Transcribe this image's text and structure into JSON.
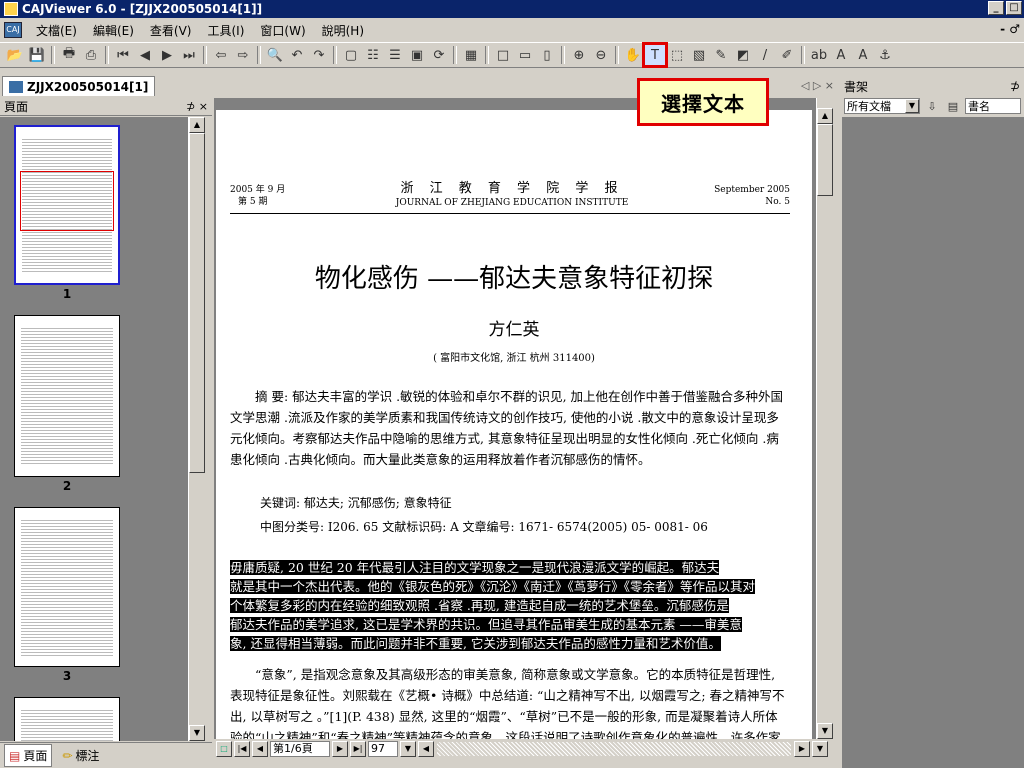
{
  "window": {
    "title": "CAJViewer 6.0 - [ZJJX200505014[1]]",
    "min": "_",
    "max": "□",
    "mdi_controls": "- ♂"
  },
  "menu": [
    "文檔(E)",
    "編輯(E)",
    "查看(V)",
    "工具(I)",
    "窗口(W)",
    "說明(H)"
  ],
  "tooltip": "選擇文本",
  "doc_tab": {
    "label": "ZJJX200505014[1]",
    "nav": "◁ ▷ ×"
  },
  "left_panel": {
    "title": "頁面",
    "controls": "⊅ ×",
    "pages": [
      "1",
      "2",
      "3"
    ]
  },
  "bottom_tabs": {
    "pages": "頁面",
    "notes": "標注"
  },
  "page": {
    "header_left": [
      "2005 年 9 月",
      "第 5 期"
    ],
    "journal_cn": "浙 江 教 育 学 院 学 报",
    "journal_en": "JOURNAL OF ZHEJIANG EDUCATION INSTITUTE",
    "header_right": [
      "September 2005",
      "No. 5"
    ],
    "title": "物化感伤 ——郁达夫意象特征初探",
    "author": "方仁英",
    "affiliation": "( 富阳市文化馆, 浙江  杭州 311400)",
    "abstract": "摘    要: 郁达夫丰富的学识 .敏锐的体验和卓尔不群的识见, 加上他在创作中善于借鉴融合多种外国文学思潮 .流派及作家的美学质素和我国传统诗文的创作技巧, 使他的小说 .散文中的意象设计呈现多元化倾向。考察郁达夫作品中隐喻的思维方式, 其意象特征呈现出明显的女性化倾向 .死亡化倾向 .病患化倾向 .古典化倾向。而大量此类意象的运用释放着作者沉郁感伤的情怀。",
    "keywords": "关键词: 郁达夫; 沉郁感伤; 意象特征",
    "classification": "中图分类号: I206. 65    文献标识码: A    文章编号: 1671- 6574(2005) 05- 0081- 06",
    "selected_lines": [
      "毋庸质疑, 20 世纪 20 年代最引人注目的文学现象之一是现代浪漫派文学的崛起。郁达夫",
      "就是其中一个杰出代表。他的《银灰色的死》《沉沦》《南迁》《茑萝行》《零余者》等作品以其对",
      "个体繁复多彩的内在经验的细致观照 .省察 .再现, 建造起自成一统的艺术堡垒。沉郁感伤是",
      "郁达夫作品的美学追求, 这已是学术界的共识。但追寻其作品审美生成的基本元素 ——审美意",
      "象, 还显得相当薄弱。而此问题并非不重要, 它关涉到郁达夫作品的感性力量和艺术价值。"
    ],
    "body": "“意象”, 是指观念意象及其高级形态的审美意象, 简称意象或文学意象。它的本质特征是哲理性, 表现特征是象征性。刘熙载在《艺概• 诗概》中总结道: “山之精神写不出, 以烟霞写之; 春之精神写不出, 以草树写之 。”[1](P. 438) 显然, 这里的“烟霞”、“草树”已不是一般的形象, 而是凝聚着诗人所体验的“山之精神”和“春之精神”等精神蕴含的意象。这段话说明了诗歌创作意象化的普遍性。许多作家在小说创作中也十分重视在造境中的意象设置。比如张爱玲、夏志"
  },
  "status": {
    "page_field": "第1/6頁",
    "zoom": "97"
  },
  "bookshelf": {
    "title": "書架",
    "pin": "⊅",
    "filter": "所有文檔",
    "column": "書名"
  },
  "colors": {
    "titlebar": "#0a246a",
    "highlight": "#e00000",
    "tooltip_bg": "#ffffc0"
  }
}
